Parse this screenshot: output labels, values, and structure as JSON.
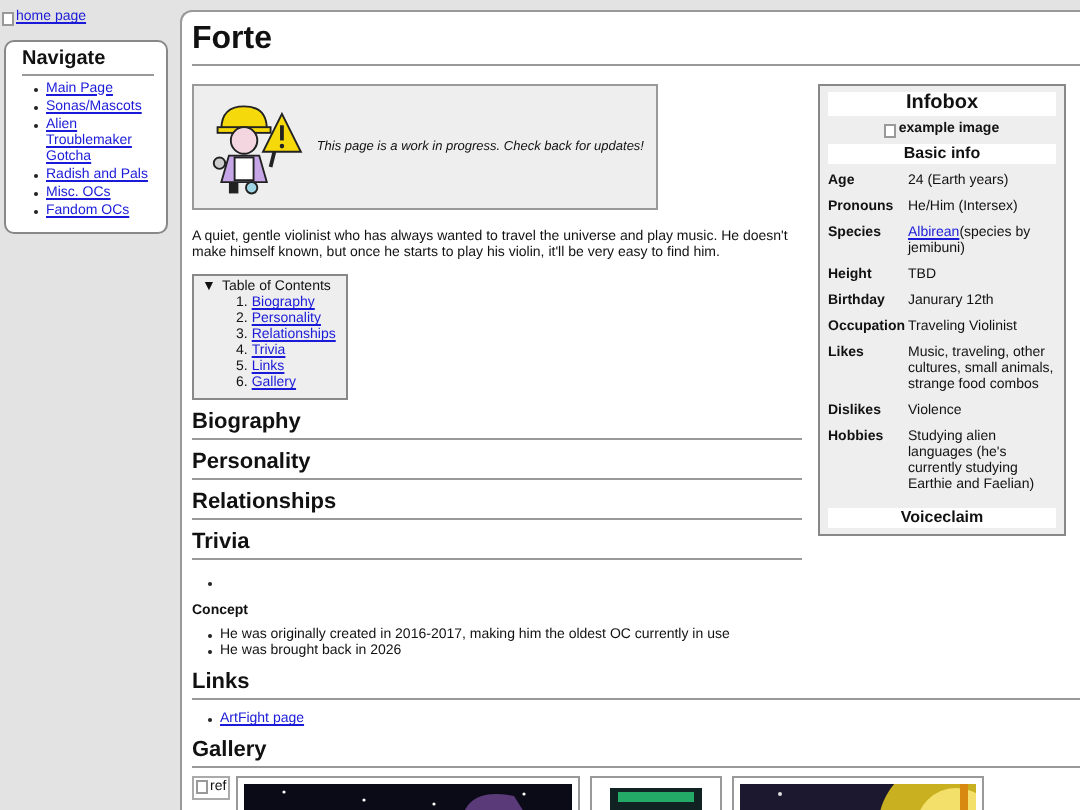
{
  "home_link": {
    "alt": "home page"
  },
  "nav": {
    "title": "Navigate",
    "items": [
      "Main Page",
      "Sonas/Mascots",
      "Alien Troublemaker Gotcha",
      "Radish and Pals",
      "Misc. OCs",
      "Fandom OCs"
    ]
  },
  "page": {
    "title": "Forte",
    "notice": "This page is a work in progress. Check back for updates!",
    "intro": "A quiet, gentle violinist who has always wanted to travel the universe and play music. He doesn't make himself known, but once he starts to play his violin, it'll be very easy to find him.",
    "toc": {
      "toggle": "▼",
      "title": "Table of Contents",
      "items": [
        {
          "num": "1.",
          "label": "Biography"
        },
        {
          "num": "2.",
          "label": "Personality"
        },
        {
          "num": "3.",
          "label": "Relationships"
        },
        {
          "num": "4.",
          "label": "Trivia"
        },
        {
          "num": "5.",
          "label": "Links"
        },
        {
          "num": "6.",
          "label": "Gallery"
        }
      ]
    },
    "infobox": {
      "title": "Infobox",
      "image_alt": "example image",
      "section": "Basic info",
      "rows": [
        {
          "label": "Age",
          "value": "24 (Earth years)"
        },
        {
          "label": "Pronouns",
          "value": "He/Him (Intersex)"
        },
        {
          "label": "Species",
          "link": "Albirean",
          "value": "(species by jemibuni)"
        },
        {
          "label": "Height",
          "value": "TBD"
        },
        {
          "label": "Birthday",
          "value": "Janurary 12th"
        },
        {
          "label": "Occupation",
          "value": "Traveling Violinist"
        },
        {
          "label": "Likes",
          "value": "Music, traveling, other cultures, small animals, strange food combos"
        },
        {
          "label": "Dislikes",
          "value": "Violence"
        },
        {
          "label": "Hobbies",
          "value": "Studying alien languages (he's currently studying Earthie and Faelian)"
        }
      ],
      "footer_title": "Voiceclaim"
    },
    "sections": [
      {
        "heading": "Biography"
      },
      {
        "heading": "Personality"
      },
      {
        "heading": "Relationships"
      },
      {
        "heading": "Trivia",
        "blocks": [
          {
            "kind": "empty_bullet"
          },
          {
            "kind": "subheading",
            "text": "Concept"
          },
          {
            "kind": "list",
            "items": [
              "He was originally created in 2016-2017, making him the oldest OC currently in use",
              "He was brought back in 2026"
            ]
          }
        ]
      },
      {
        "heading": "Links",
        "blocks": [
          {
            "kind": "links",
            "items": [
              "ArtFight page"
            ]
          }
        ]
      },
      {
        "heading": "Gallery",
        "blocks": [
          {
            "kind": "gallery",
            "items": [
              {
                "kind": "broken_image",
                "alt": "ref"
              },
              {
                "kind": "picture"
              },
              {
                "kind": "picture"
              },
              {
                "kind": "picture"
              }
            ]
          }
        ]
      }
    ]
  }
}
